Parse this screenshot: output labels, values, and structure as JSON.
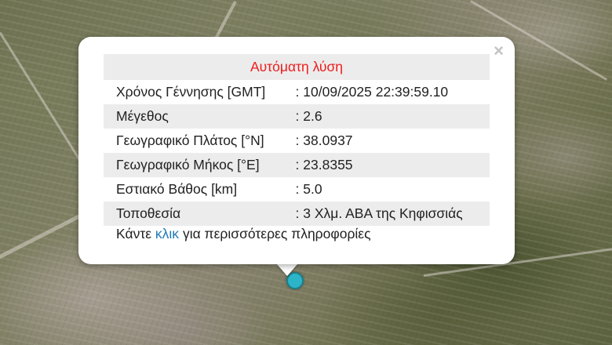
{
  "popup": {
    "header": "Αυτόματη λύση",
    "close_symbol": "×",
    "rows": [
      {
        "label": "Χρόνος Γέννησης [GMT]",
        "value": ": 10/09/2025 22:39:59.10"
      },
      {
        "label": "Μέγεθος",
        "value": ": 2.6"
      },
      {
        "label": "Γεωγραφικό Πλάτος [°N]",
        "value": ": 38.0937"
      },
      {
        "label": "Γεωγραφικό Μήκος [°E]",
        "value": ": 23.8355"
      },
      {
        "label": "Εστιακό Βάθος [km]",
        "value": ": 5.0"
      },
      {
        "label": "Τοποθεσία",
        "value": ": 3 Χλμ. ΑΒΑ της Κηφισσιάς"
      }
    ],
    "more_prefix": "Κάντε",
    "more_link": "κλικ",
    "more_suffix": "για περισσότερες πληροφορίες"
  },
  "colors": {
    "header_text": "#ee1c1c",
    "link_text": "#1f7ab9",
    "marker_fill": "#2cb5c8",
    "row_shade": "#ececec"
  },
  "icons": {
    "close": "close-icon",
    "marker": "earthquake-marker-icon"
  }
}
